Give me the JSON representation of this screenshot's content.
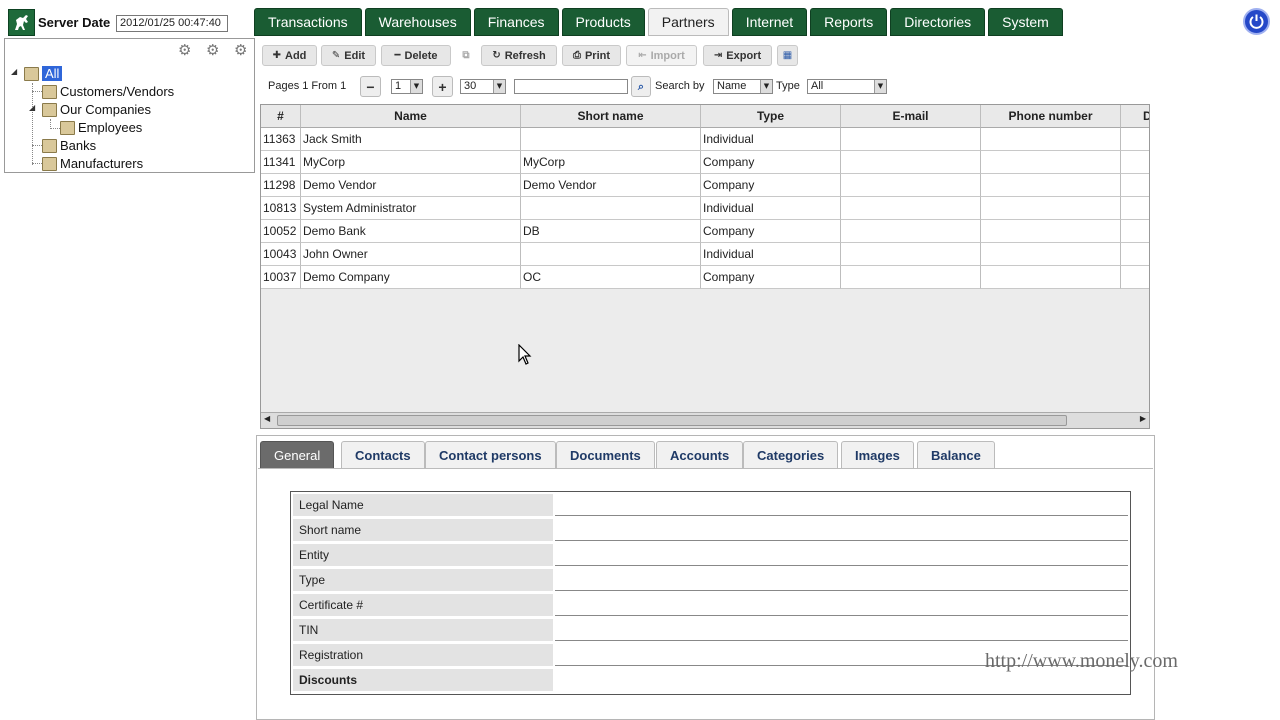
{
  "header": {
    "server_label": "Server Date",
    "server_date": "2012/01/25  00:47:40"
  },
  "nav": {
    "tabs": [
      "Transactions",
      "Warehouses",
      "Finances",
      "Products",
      "Partners",
      "Internet",
      "Reports",
      "Directories",
      "System"
    ],
    "active": "Partners"
  },
  "tree": {
    "nodes": [
      "All",
      "Customers/Vendors",
      "Our Companies",
      "Employees",
      "Banks",
      "Manufacturers"
    ],
    "selected": "All"
  },
  "toolbar": {
    "add": "Add",
    "edit": "Edit",
    "delete": "Delete",
    "refresh": "Refresh",
    "print": "Print",
    "import": "Import",
    "export": "Export"
  },
  "pager": {
    "pages_text": "Pages 1 From 1",
    "page_value": "1",
    "page_size": "30",
    "search_value": "",
    "search_by_label": "Search by",
    "search_by_value": "Name",
    "type_label": "Type",
    "type_value": "All"
  },
  "grid": {
    "columns": [
      "#",
      "Name",
      "Short name",
      "Type",
      "E-mail",
      "Phone number",
      "D"
    ],
    "rows": [
      [
        "11363",
        "Jack  Smith",
        "",
        "Individual",
        "",
        "",
        ""
      ],
      [
        "11341",
        "MyCorp",
        "MyCorp",
        "Company",
        "",
        "",
        ""
      ],
      [
        "11298",
        "Demo Vendor",
        "Demo Vendor",
        "Company",
        "",
        "",
        ""
      ],
      [
        "10813",
        "System  Administrator",
        "",
        "Individual",
        "",
        "",
        ""
      ],
      [
        "10052",
        "Demo Bank",
        "DB",
        "Company",
        "",
        "",
        ""
      ],
      [
        "10043",
        "John  Owner",
        "",
        "Individual",
        "",
        "",
        ""
      ],
      [
        "10037",
        "Demo Company",
        "OC",
        "Company",
        "",
        "",
        ""
      ]
    ]
  },
  "detail": {
    "tabs": [
      "General",
      "Contacts",
      "Contact persons",
      "Documents",
      "Accounts",
      "Categories",
      "Images",
      "Balance"
    ],
    "active": "General",
    "fields": [
      {
        "label": "Legal Name",
        "value": ""
      },
      {
        "label": "Short name",
        "value": ""
      },
      {
        "label": "Entity",
        "value": ""
      },
      {
        "label": "Type",
        "value": ""
      },
      {
        "label": "Certificate #",
        "value": ""
      },
      {
        "label": "TIN",
        "value": ""
      },
      {
        "label": "Registration",
        "value": ""
      },
      {
        "label": "Discounts",
        "value": ""
      }
    ]
  },
  "watermark": "http://www.monely.com",
  "colors": {
    "nav_bg": "#1a5c33",
    "tree_selected": "#2f66d9",
    "power_button": "#2548c8",
    "active_detail_tab": "#6b6b6b"
  }
}
